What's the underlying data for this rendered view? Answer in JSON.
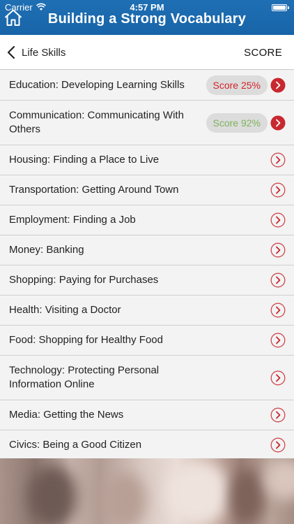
{
  "status_bar": {
    "carrier": "Carrier",
    "time": "4:57 PM"
  },
  "header": {
    "title": "Building a Strong Vocabulary"
  },
  "nav": {
    "back_label": "Life Skills",
    "score_label": "SCORE"
  },
  "colors": {
    "header_blue": "#1864a8",
    "chevron_red": "#c8282f",
    "score_low": "#d2232a",
    "score_high": "#7db35c"
  },
  "lessons": [
    {
      "title": "Education: Developing Learning Skills",
      "score": "Score 25%",
      "score_level": "low",
      "icon": "chevron-right-filled-icon"
    },
    {
      "title": "Communication: Communicating With Others",
      "score": "Score 92%",
      "score_level": "high",
      "icon": "chevron-right-filled-icon"
    },
    {
      "title": "Housing: Finding a Place to Live",
      "icon": "chevron-right-outline-icon"
    },
    {
      "title": "Transportation: Getting Around Town",
      "icon": "chevron-right-outline-icon"
    },
    {
      "title": "Employment: Finding a Job",
      "icon": "chevron-right-outline-icon"
    },
    {
      "title": "Money: Banking",
      "icon": "chevron-right-outline-icon"
    },
    {
      "title": "Shopping: Paying for Purchases",
      "icon": "chevron-right-outline-icon"
    },
    {
      "title": "Health: Visiting a Doctor",
      "icon": "chevron-right-outline-icon"
    },
    {
      "title": "Food: Shopping for Healthy Food",
      "icon": "chevron-right-outline-icon"
    },
    {
      "title": "Technology: Protecting Personal Information Online",
      "icon": "chevron-right-outline-icon"
    },
    {
      "title": "Media: Getting the News",
      "icon": "chevron-right-outline-icon"
    },
    {
      "title": "Civics: Being a Good Citizen",
      "icon": "chevron-right-outline-icon"
    }
  ]
}
